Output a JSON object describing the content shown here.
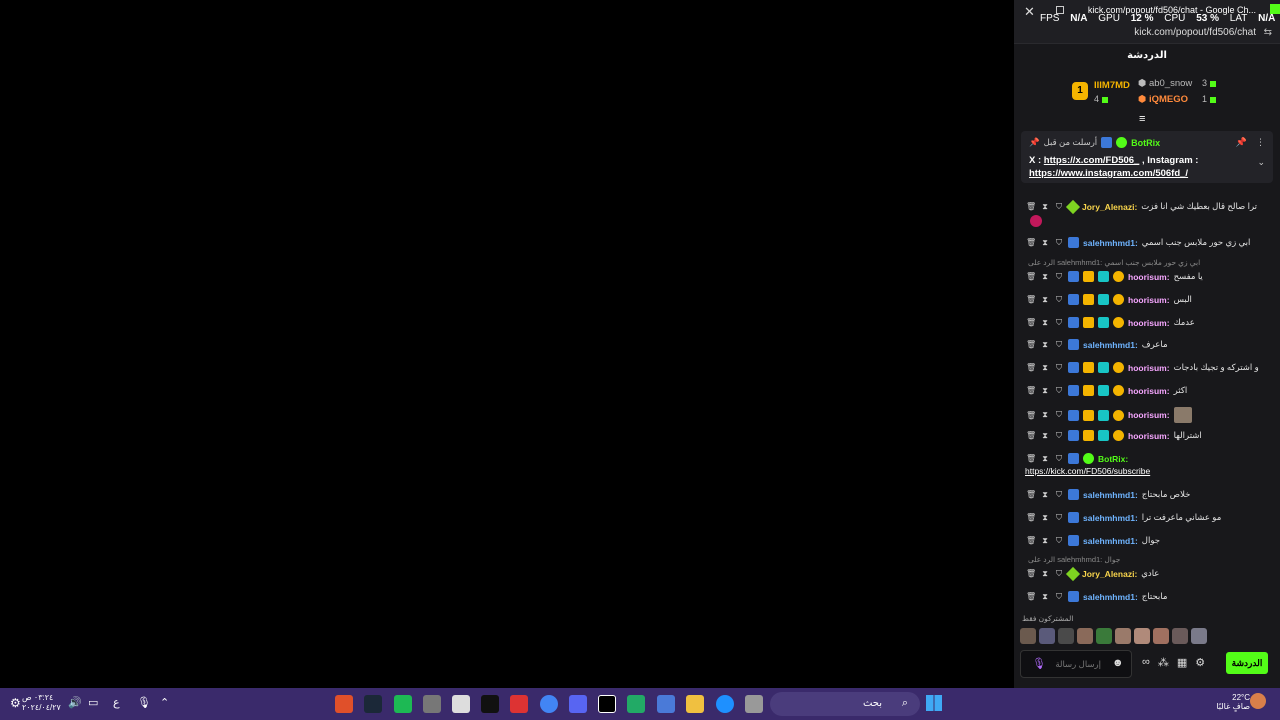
{
  "window": {
    "title": "kick.com/popout/fd506/chat - Google Ch...",
    "url": "kick.com/popout/fd506/chat"
  },
  "hud": {
    "fps_label": "FPS",
    "fps_value": "N/A",
    "gpu_label": "GPU",
    "gpu_value": "12 %",
    "cpu_label": "CPU",
    "cpu_value": "53 %",
    "lat_label": "LAT",
    "lat_value": "N/A"
  },
  "chat": {
    "header": "الدردشة",
    "leaderboard": [
      {
        "rank": "1",
        "name": "IIIM7MD",
        "count": "4"
      },
      {
        "name": "ab0_snow",
        "count": "3"
      },
      {
        "name": "iQMEGO",
        "count": "1"
      }
    ],
    "pinned": {
      "pinned_by": "أرسلت من قبل",
      "author": "BotRix",
      "text1": "X : ",
      "link1": "https://x.com/FD506_",
      "text2": " , Instagram : ",
      "link2": "https://www.instagram.com/506fd_/"
    },
    "messages": [
      {
        "user": "Jory_Alenazi:",
        "text": "ترا صالح قال بعطيك شي انا فزت"
      },
      {
        "user": "salehmhmd1:",
        "text": "ابي زي حور ملابس جنب اسمي"
      },
      {
        "reply": "الرد على salehmhmd1: ابي زي حور ملابس جنب اسمي"
      },
      {
        "user": "hoorisum:",
        "text": "يا مفسح"
      },
      {
        "user": "hoorisum:",
        "text": "البس"
      },
      {
        "user": "hoorisum:",
        "text": "عدمك"
      },
      {
        "user": "salehmhmd1:",
        "text": "ماعرف"
      },
      {
        "user": "hoorisum:",
        "text": "و اشتركه و تجيك بادجات"
      },
      {
        "user": "hoorisum:",
        "text": "اكثر"
      },
      {
        "user": "hoorisum:",
        "text": ""
      },
      {
        "user": "hoorisum:",
        "text": "اشترالها"
      },
      {
        "user": "BotRix:",
        "text": "",
        "link": "https://kick.com/FD506/subscribe"
      },
      {
        "user": "salehmhmd1:",
        "text": "خلاص مابحتاج"
      },
      {
        "user": "salehmhmd1:",
        "text": "مو عشاني ماعرفت ترا"
      },
      {
        "user": "salehmhmd1:",
        "text": "جوال"
      },
      {
        "reply": "الرد على salehmhmd1: جوال"
      },
      {
        "user": "Jory_Alenazi:",
        "text": "عادي"
      },
      {
        "user": "salehmhmd1:",
        "text": "مابحتاج"
      }
    ],
    "subs_label": "المشتركون فقط",
    "input_placeholder": "إرسال رسالة",
    "send_label": "الدردشة",
    "brand_color": "#53fc18"
  },
  "taskbar": {
    "search_label": "بحث",
    "clock_line1": "٠٣:٢٤ ص",
    "clock_line2": "٢٠٢٤/٠٤/٢٧",
    "weather_temp": "22°C",
    "weather_desc": "صافٍ غالبًا",
    "lang": "ع"
  }
}
